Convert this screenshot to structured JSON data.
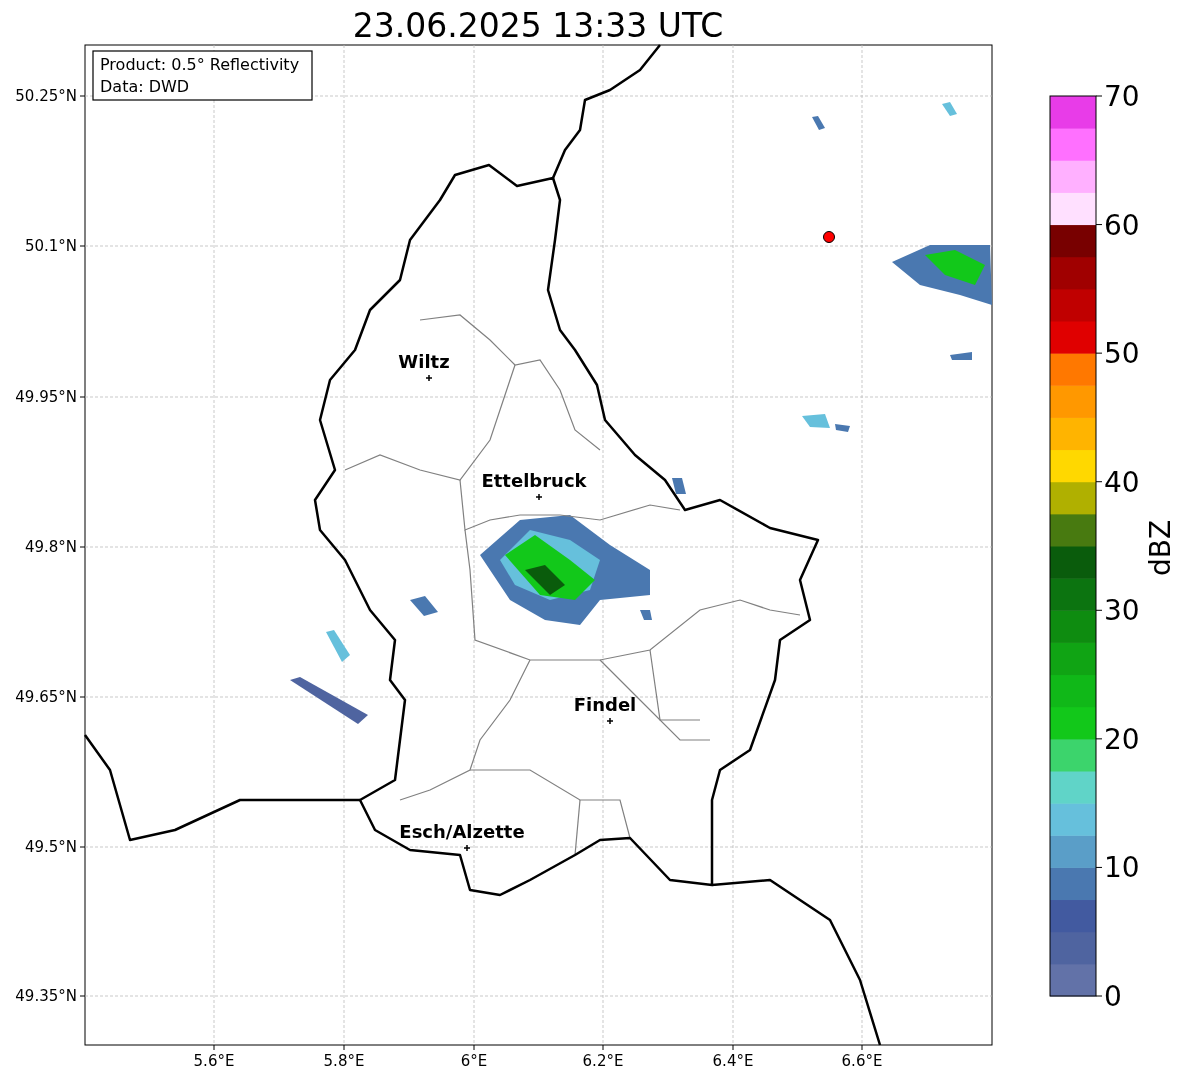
{
  "title": "23.06.2025 13:33 UTC",
  "map": {
    "lat_labels": [
      "50.25°N",
      "50.1°N",
      "49.95°N",
      "49.8°N",
      "49.65°N",
      "49.5°N",
      "49.35°N"
    ],
    "lon_labels": [
      "5.6°E",
      "5.8°E",
      "6°E",
      "6.2°E",
      "6.4°E",
      "6.6°E"
    ],
    "places": [
      {
        "name": "Wiltz"
      },
      {
        "name": "Ettelbruck"
      },
      {
        "name": "Findel"
      },
      {
        "name": "Esch/Alzette"
      }
    ]
  },
  "info_box": [
    "Product: 0.5° Reflectivity",
    "Data: DWD"
  ],
  "colorbar": {
    "label": "dBZ",
    "ticks": [
      "70",
      "60",
      "50",
      "40",
      "30",
      "20",
      "10",
      "0"
    ]
  }
}
